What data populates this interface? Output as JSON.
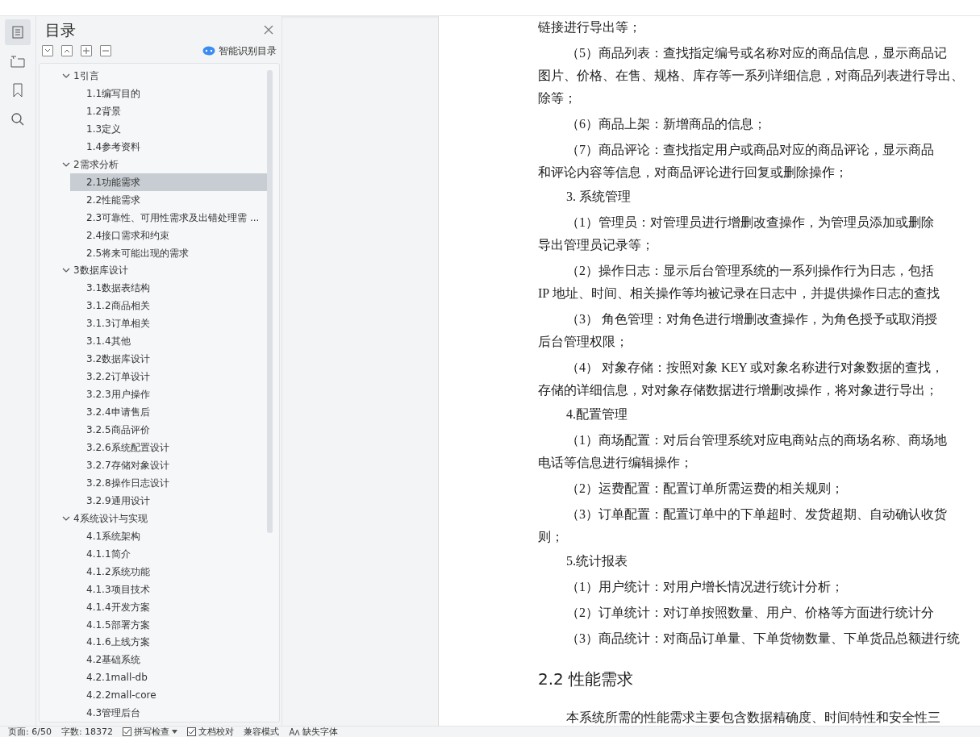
{
  "rail": [
    {
      "kind": "toc",
      "selected": true
    },
    {
      "kind": "nav",
      "selected": false
    },
    {
      "kind": "bookmark",
      "selected": false
    },
    {
      "kind": "search",
      "selected": false
    }
  ],
  "toc": {
    "title": "目录",
    "smart_button": "智能识别目录",
    "items": [
      {
        "label": "1引言",
        "expanded": true,
        "selected": false,
        "children": [
          {
            "label": "1.1编写目的",
            "selected": false
          },
          {
            "label": "1.2背景",
            "selected": false
          },
          {
            "label": "1.3定义",
            "selected": false
          },
          {
            "label": "1.4参考资料",
            "selected": false
          }
        ]
      },
      {
        "label": "2需求分析",
        "expanded": true,
        "selected": false,
        "children": [
          {
            "label": "2.1功能需求",
            "selected": true
          },
          {
            "label": "2.2性能需求",
            "selected": false
          },
          {
            "label": "2.3可靠性、可用性需求及出错处理需 ...",
            "selected": false
          },
          {
            "label": "2.4接口需求和约束",
            "selected": false
          },
          {
            "label": "2.5将来可能出现的需求",
            "selected": false
          }
        ]
      },
      {
        "label": "3数据库设计",
        "expanded": true,
        "selected": false,
        "children": [
          {
            "label": "3.1数据表结构",
            "selected": false
          },
          {
            "label": "3.1.2商品相关",
            "selected": false
          },
          {
            "label": "3.1.3订单相关",
            "selected": false
          },
          {
            "label": "3.1.4其他",
            "selected": false
          },
          {
            "label": "3.2数据库设计",
            "selected": false
          },
          {
            "label": "3.2.2订单设计",
            "selected": false
          },
          {
            "label": "3.2.3用户操作",
            "selected": false
          },
          {
            "label": "3.2.4申请售后",
            "selected": false
          },
          {
            "label": "3.2.5商品评价",
            "selected": false
          },
          {
            "label": "3.2.6系统配置设计",
            "selected": false
          },
          {
            "label": "3.2.7存储对象设计",
            "selected": false
          },
          {
            "label": "3.2.8操作日志设计",
            "selected": false
          },
          {
            "label": "3.2.9通用设计",
            "selected": false
          }
        ]
      },
      {
        "label": "4系统设计与实现",
        "expanded": true,
        "selected": false,
        "children": [
          {
            "label": "4.1系统架构",
            "selected": false
          },
          {
            "label": "4.1.1简介",
            "selected": false
          },
          {
            "label": "4.1.2系统功能",
            "selected": false
          },
          {
            "label": "4.1.3项目技术",
            "selected": false
          },
          {
            "label": "4.1.4开发方案",
            "selected": false
          },
          {
            "label": "4.1.5部署方案",
            "selected": false
          },
          {
            "label": "4.1.6上线方案",
            "selected": false
          },
          {
            "label": "4.2基础系统",
            "selected": false
          },
          {
            "label": "4.2.1mall-db",
            "selected": false
          },
          {
            "label": "4.2.2mall-core",
            "selected": false
          },
          {
            "label": "4.3管理后台",
            "selected": false
          }
        ]
      }
    ]
  },
  "document": {
    "lines": [
      {
        "kind": "cont",
        "text": "链接进行导出等；"
      },
      {
        "kind": "first",
        "text": "（5）商品列表：查找指定编号或名称对应的商品信息，显示商品记"
      },
      {
        "kind": "cont",
        "text": "图片、价格、在售、规格、库存等一系列详细信息，对商品列表进行导出、"
      },
      {
        "kind": "cont",
        "text": "除等；"
      },
      {
        "kind": "first",
        "text": "（6）商品上架：新增商品的信息；"
      },
      {
        "kind": "first",
        "text": "（7）商品评论：查找指定用户或商品对应的商品评论，显示商品"
      },
      {
        "kind": "cont",
        "text": "和评论内容等信息，对商品评论进行回复或删除操作；"
      },
      {
        "kind": "sub",
        "text": "3. 系统管理"
      },
      {
        "kind": "first",
        "text": "（1）管理员：对管理员进行增删改查操作，为管理员添加或删除"
      },
      {
        "kind": "cont",
        "text": "导出管理员记录等；"
      },
      {
        "kind": "first",
        "text": "（2）操作日志：显示后台管理系统的一系列操作行为日志，包括"
      },
      {
        "kind": "cont",
        "text": "IP 地址、时间、相关操作等均被记录在日志中，并提供操作日志的查找"
      },
      {
        "kind": "first",
        "text": "（3） 角色管理：对角色进行增删改查操作，为角色授予或取消授"
      },
      {
        "kind": "cont",
        "text": "后台管理权限；"
      },
      {
        "kind": "first",
        "text": "（4） 对象存储：按照对象 KEY 或对象名称进行对象数据的查找，"
      },
      {
        "kind": "cont",
        "text": "存储的详细信息，对对象存储数据进行增删改操作，将对象进行导出；"
      },
      {
        "kind": "sub",
        "text": "4.配置管理"
      },
      {
        "kind": "first",
        "text": "（1）商场配置：对后台管理系统对应电商站点的商场名称、商场地"
      },
      {
        "kind": "cont",
        "text": "电话等信息进行编辑操作；"
      },
      {
        "kind": "first",
        "text": "（2）运费配置：配置订单所需运费的相关规则；"
      },
      {
        "kind": "first",
        "text": "（3）订单配置：配置订单中的下单超时、发货超期、自动确认收货"
      },
      {
        "kind": "cont",
        "text": "则；"
      },
      {
        "kind": "sub",
        "text": "5.统计报表"
      },
      {
        "kind": "first",
        "text": "（1）用户统计：对用户增长情况进行统计分析；"
      },
      {
        "kind": "first",
        "text": "（2）订单统计：对订单按照数量、用户、价格等方面进行统计分"
      },
      {
        "kind": "first",
        "text": "（3）商品统计：对商品订单量、下单货物数量、下单货品总额进行统"
      },
      {
        "kind": "heading",
        "text": "2.2 性能需求"
      },
      {
        "kind": "first",
        "text": "本系统所需的性能需求主要包含数据精确度、时间特性和安全性三"
      }
    ]
  },
  "status_bar": {
    "page": "页面: 6/50",
    "words": "字数: 18372",
    "spell_check": {
      "label": "拼写检查",
      "checked": true
    },
    "proofread": {
      "label": "文档校对",
      "checked": true
    },
    "mode": "兼容模式",
    "fonts": "缺失字体"
  }
}
